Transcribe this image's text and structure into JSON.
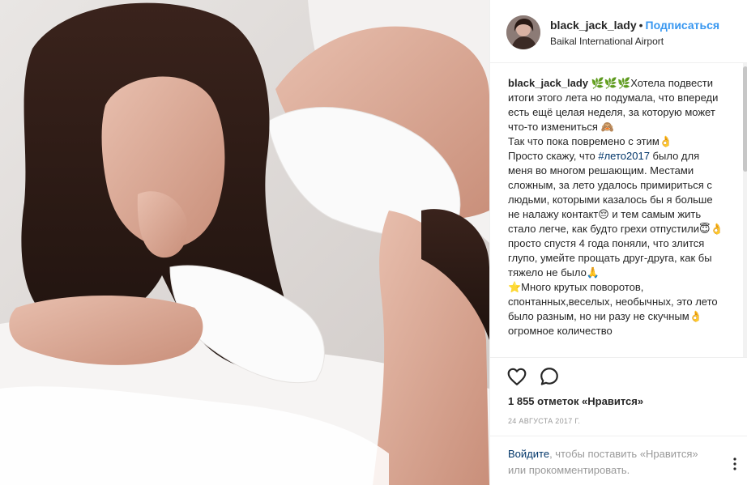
{
  "post": {
    "username": "black_jack_lady",
    "separator": "•",
    "follow_label": "Подписаться",
    "location": "Baikal International Airport"
  },
  "caption": {
    "username": "black_jack_lady",
    "part1": " 🌿🌿🌿Хотела подвести итоги этого лета но подумала, что впереди есть ещё целая неделя, за которую может что-то измениться 🙈\nТак что пока повремено с этим👌\nПросто скажу, что ",
    "hashtag": "#лето2017",
    "part2": " было для меня во многом решающим. Местами сложным, за лето удалось примириться с людьми, которыми казалось бы я больше не налажу контакт😔 и тем самым жить стало легче, как будто грехи отпустили😇👌 просто спустя 4 года поняли, что злится глупо, умейте прощать друг-друга, как бы тяжело не было🙏\n⭐Много крутых поворотов, спонтанных,веселых, необычных, это лето было разным, но ни разу не скучным👌огромное количество"
  },
  "likes_text": "1 855 отметок «Нравится»",
  "date_text": "24 АВГУСТА 2017 Г.",
  "footer": {
    "login_link": "Войдите",
    "login_rest": ", чтобы поставить «Нравится» или прокомментировать."
  },
  "icons": {
    "like": "heart-icon",
    "comment": "comment-icon",
    "more": "more-options-icon"
  },
  "colors": {
    "link_blue": "#3897f0",
    "text": "#262626",
    "muted": "#999999",
    "hashtag": "#003569"
  }
}
